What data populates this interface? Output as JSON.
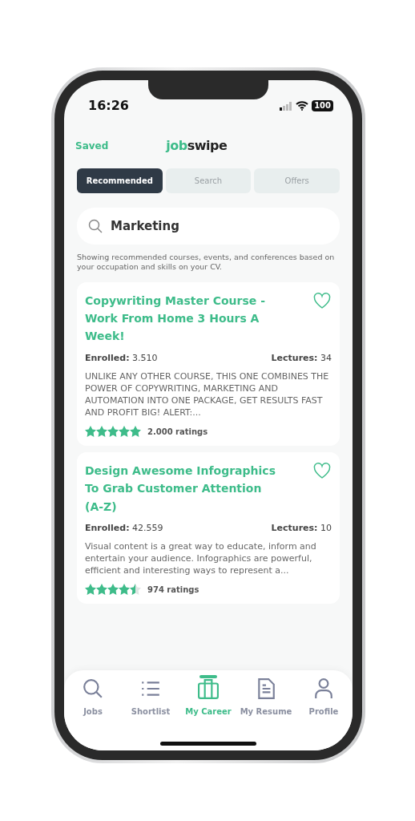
{
  "status_bar": {
    "time": "16:26",
    "battery": "100"
  },
  "header": {
    "saved": "Saved",
    "logo": {
      "accent": "job",
      "rest": "swipe"
    }
  },
  "tabs": [
    {
      "label": "Recommended",
      "selected": true
    },
    {
      "label": "Search",
      "selected": false
    },
    {
      "label": "Offers",
      "selected": false
    }
  ],
  "search": {
    "value": "Marketing"
  },
  "note": "Showing recommended courses, events, and conferences based on your occupation and skills on your CV.",
  "courses": [
    {
      "title": "Copywriting Master Course - Work From Home 3 Hours A Week!",
      "favorite": false,
      "enrolled": "**Enrolled:** 3.510",
      "lectures": "**Lectures:** 34",
      "description": "UNLIKE ANY OTHER COURSE, THIS ONE COMBINES THE POWER OF COPYWRITING, MARKETING AND AUTOMATION INTO ONE PACKAGE, GET RESULTS FAST AND PROFIT BIG! ALERT:...",
      "stars": 5,
      "ratings": "2.000 ratings"
    },
    {
      "title": "Design Awesome Infographics To Grab Customer Attention (A-Z)",
      "favorite": false,
      "enrolled": "**Enrolled:** 42.559",
      "lectures": "**Lectures:** 10",
      "description": "Visual content is a great way to educate, inform and entertain your audience. Infographics are powerful, efficient and interesting ways to represent a...",
      "stars": 4.5,
      "ratings": "974 ratings"
    }
  ],
  "bottom_nav": [
    {
      "label": "Jobs",
      "selected": false
    },
    {
      "label": "Shortlist",
      "selected": false
    },
    {
      "label": "My Career",
      "selected": true
    },
    {
      "label": "My Resume",
      "selected": false
    },
    {
      "label": "Profile",
      "selected": false
    }
  ]
}
